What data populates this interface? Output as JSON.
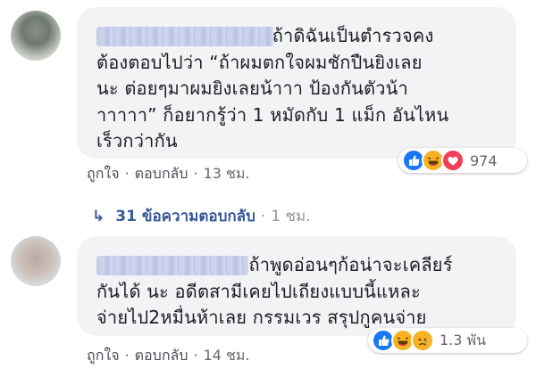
{
  "comments": [
    {
      "author_redacted": true,
      "lines": [
        "                              ถ้าดิฉันเป็นตำรวจคง",
        "ต้องตอบไปว่า “ถ้าผมตกใจผมชักปืนยิงเลย",
        "นะ ต่อยๆมาผมยิงเลยน้าาา ป้องกันตัวน้า",
        "าาาาา” ก็อยากรู้ว่า 1 หมัดกับ 1 แม็ก อันไหน",
        "เร็วกว่ากัน"
      ],
      "like_label": "ถูกใจ",
      "reply_label": "ตอบกลับ",
      "time": "13 ชม.",
      "reactions": [
        "like",
        "haha",
        "love"
      ],
      "reaction_count": "974"
    },
    {
      "author_redacted": true,
      "lines": [
        "                          ถ้าพูดอ่อนๆก้อน่าจะเคลียร์",
        "กันได้ นะ อดีตสามีเคยไปเถียงแบบนี้แหละ",
        "จ่ายไป2หมื่นห้าเลย กรรมเวร สรุปกูคนจ่าย"
      ],
      "like_label": "ถูกใจ",
      "reply_label": "ตอบกลับ",
      "time": "14 ชม.",
      "reactions": [
        "like",
        "haha",
        "sad"
      ],
      "reaction_count": "1.3 พัน"
    }
  ],
  "replies_link": {
    "arrow": "↳",
    "label": "31 ข้อความตอบกลับ",
    "time": "1 ชม."
  },
  "colors": {
    "bubble": "#f2f3f5",
    "link": "#385898",
    "like": "#1877f2",
    "haha": "#f7b125",
    "love": "#f33e58"
  }
}
